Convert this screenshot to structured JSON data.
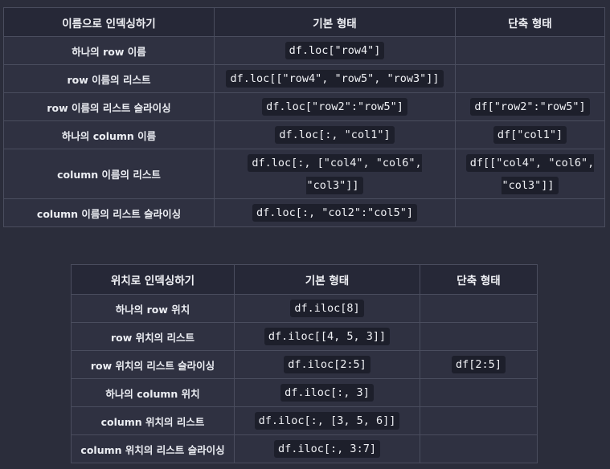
{
  "table1": {
    "headers": [
      "이름으로 인덱싱하기",
      "기본 형태",
      "단축 형태"
    ],
    "rows": [
      {
        "label": "하나의 row 이름",
        "basic": "df.loc[\"row4\"]",
        "short": ""
      },
      {
        "label": "row 이름의 리스트",
        "basic": "df.loc[[\"row4\", \"row5\", \"row3\"]]",
        "short": ""
      },
      {
        "label": "row 이름의 리스트 슬라이싱",
        "basic": "df.loc[\"row2\":\"row5\"]",
        "short": "df[\"row2\":\"row5\"]"
      },
      {
        "label": "하나의 column 이름",
        "basic": "df.loc[:, \"col1\"]",
        "short": "df[\"col1\"]"
      },
      {
        "label": "column 이름의 리스트",
        "basic": "df.loc[:, [\"col4\", \"col6\", \"col3\"]]",
        "short": "df[[\"col4\", \"col6\", \"col3\"]]"
      },
      {
        "label": "column 이름의 리스트 슬라이싱",
        "basic": "df.loc[:, \"col2\":\"col5\"]",
        "short": ""
      }
    ]
  },
  "table2": {
    "headers": [
      "위치로 인덱싱하기",
      "기본 형태",
      "단축 형태"
    ],
    "rows": [
      {
        "label": "하나의 row 위치",
        "basic": "df.iloc[8]",
        "short": ""
      },
      {
        "label": "row 위치의 리스트",
        "basic": "df.iloc[[4, 5, 3]]",
        "short": ""
      },
      {
        "label": "row 위치의 리스트 슬라이싱",
        "basic": "df.iloc[2:5]",
        "short": "df[2:5]"
      },
      {
        "label": "하나의 column 위치",
        "basic": "df.iloc[:, 3]",
        "short": ""
      },
      {
        "label": "column 위치의 리스트",
        "basic": "df.iloc[:, [3, 5, 6]]",
        "short": ""
      },
      {
        "label": "column 위치의 리스트 슬라이싱",
        "basic": "df.iloc[:, 3:7]",
        "short": ""
      }
    ]
  }
}
